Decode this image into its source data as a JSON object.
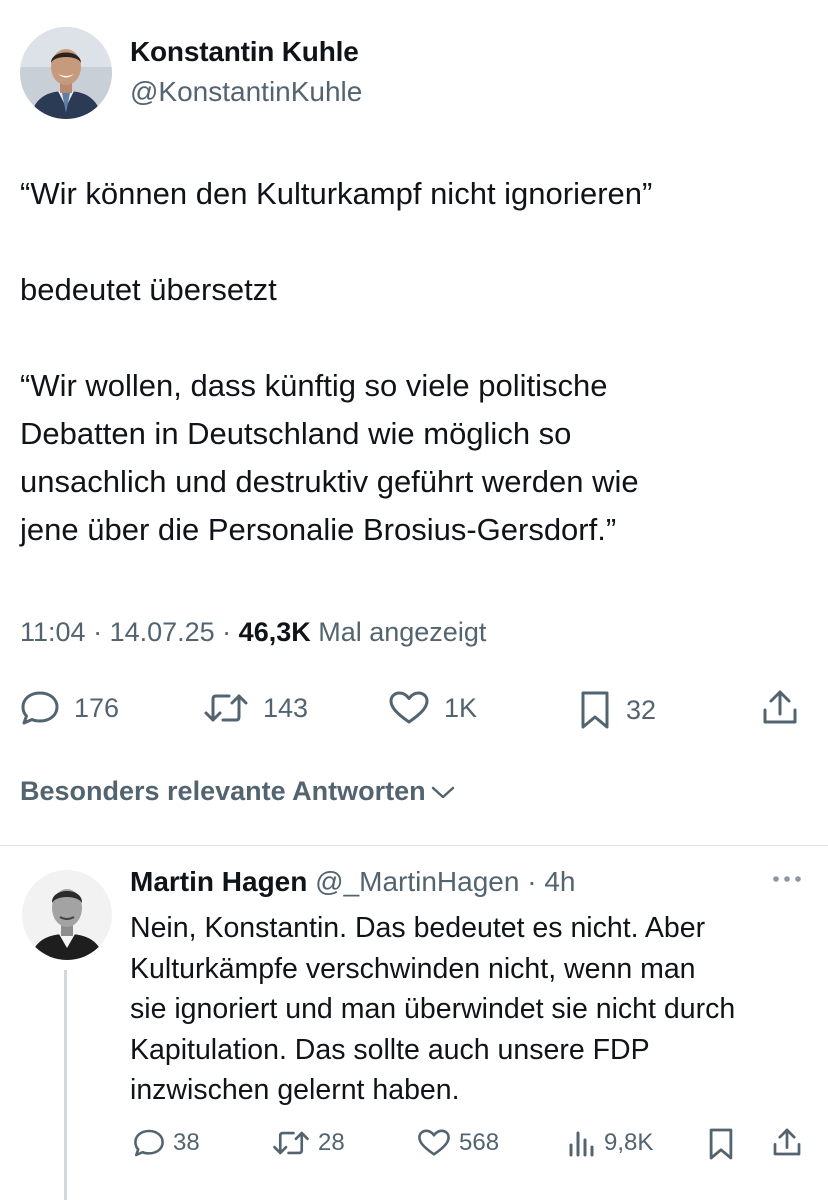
{
  "tweet": {
    "author_name": "Konstantin Kuhle",
    "author_handle": "@KonstantinKuhle",
    "text_paragraphs": [
      "“Wir können den Kulturkampf nicht ignorieren”",
      "bedeutet übersetzt",
      "“Wir wollen, dass künftig so viele politische\nDebatten in Deutschland wie möglich so\nunsachlich und destruktiv geführt werden wie\njene über die Personalie Brosius-Gersdorf.”"
    ],
    "time": "11:04",
    "sep1": " · ",
    "date": "14.07.25",
    "sep2": " · ",
    "views": "46,3K",
    "views_label": " Mal angezeigt",
    "actions": {
      "replies": "176",
      "reposts": "143",
      "likes": "1K",
      "bookmarks": "32"
    },
    "icons": [
      "reply-icon",
      "repost-icon",
      "like-icon",
      "bookmark-icon",
      "share-icon"
    ]
  },
  "replies_sort": {
    "label": "Besonders relevante Antworten",
    "icon": "chevron-down-icon"
  },
  "reply": {
    "author_name": "Martin Hagen",
    "author_handle": "@_MartinHagen",
    "separator": " · ",
    "time": "4h",
    "more_icon": "more-icon",
    "text_lines": [
      "Nein, Konstantin. Das bedeutet es nicht. Aber",
      "Kulturkämpfe verschwinden nicht, wenn man",
      "sie ignoriert und man überwindet sie nicht durch",
      "Kapitulation. Das sollte auch unsere FDP",
      "inzwischen gelernt haben."
    ],
    "actions": {
      "replies": "38",
      "reposts": "28",
      "likes": "568",
      "views": "9,8K"
    }
  },
  "colors": {
    "text": "#0f1419",
    "secondary": "#536471",
    "divider": "#dfe3e6",
    "thread_line": "#cfd9de",
    "background": "#ffffff"
  }
}
